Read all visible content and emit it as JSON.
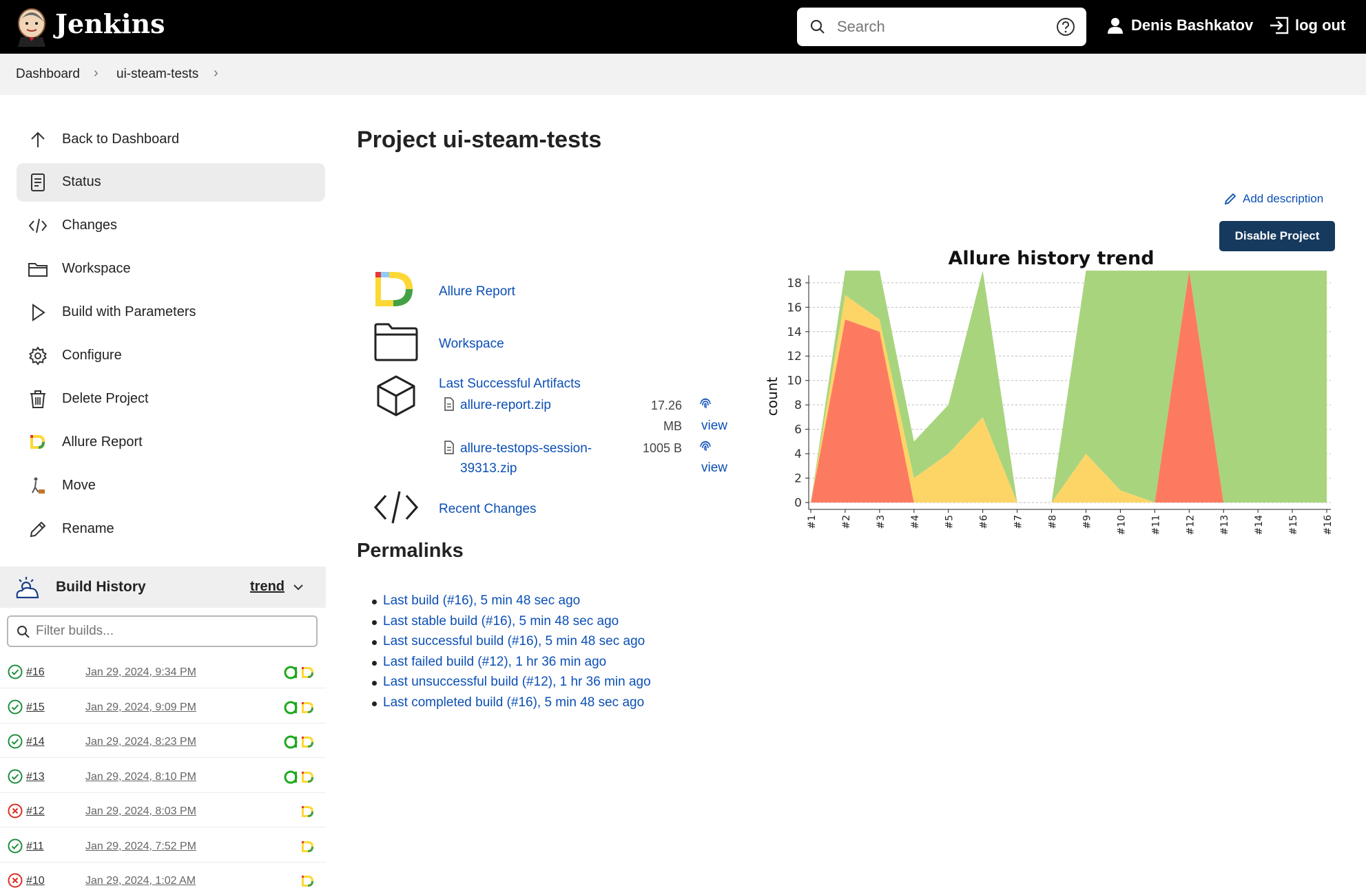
{
  "header": {
    "brand": "Jenkins",
    "search_placeholder": "Search",
    "user_name": "Denis Bashkatov",
    "logout_label": "log out"
  },
  "breadcrumb": [
    "Dashboard",
    "ui-steam-tests"
  ],
  "sidebar": {
    "items": [
      {
        "label": "Back to Dashboard",
        "icon": "arrow-up-icon"
      },
      {
        "label": "Status",
        "icon": "document-icon",
        "active": true
      },
      {
        "label": "Changes",
        "icon": "code-icon"
      },
      {
        "label": "Workspace",
        "icon": "folder-icon"
      },
      {
        "label": "Build with Parameters",
        "icon": "play-icon"
      },
      {
        "label": "Configure",
        "icon": "gear-icon"
      },
      {
        "label": "Delete Project",
        "icon": "trash-icon"
      },
      {
        "label": "Allure Report",
        "icon": "allure-icon"
      },
      {
        "label": "Move",
        "icon": "move-icon"
      },
      {
        "label": "Rename",
        "icon": "pencil-icon"
      }
    ]
  },
  "build_history": {
    "title": "Build History",
    "trend_label": "trend",
    "filter_placeholder": "Filter builds...",
    "builds": [
      {
        "number": "#16",
        "date": "Jan 29, 2024, 9:34 PM",
        "status": "success",
        "testops": true
      },
      {
        "number": "#15",
        "date": "Jan 29, 2024, 9:09 PM",
        "status": "success",
        "testops": true
      },
      {
        "number": "#14",
        "date": "Jan 29, 2024, 8:23 PM",
        "status": "success",
        "testops": true
      },
      {
        "number": "#13",
        "date": "Jan 29, 2024, 8:10 PM",
        "status": "success",
        "testops": true
      },
      {
        "number": "#12",
        "date": "Jan 29, 2024, 8:03 PM",
        "status": "failed",
        "testops": false
      },
      {
        "number": "#11",
        "date": "Jan 29, 2024, 7:52 PM",
        "status": "success",
        "testops": false
      },
      {
        "number": "#10",
        "date": "Jan 29, 2024, 1:02 AM",
        "status": "failed",
        "testops": false
      }
    ]
  },
  "main": {
    "title": "Project ui-steam-tests",
    "add_description": "Add description",
    "disable_button": "Disable Project",
    "links": {
      "allure_report": "Allure Report",
      "workspace": "Workspace",
      "last_artifacts": "Last Successful Artifacts",
      "recent_changes": "Recent Changes"
    },
    "artifacts": [
      {
        "name_line1": "allure-report.zip",
        "name_line2": "",
        "size_line1": "17.26",
        "size_line2": "MB",
        "view": "view"
      },
      {
        "name_line1": "allure-testops-session-",
        "name_line2": "39313.zip",
        "size_line1": "1005 B",
        "size_line2": "",
        "view": "view"
      }
    ],
    "permalinks_title": "Permalinks",
    "permalinks": [
      "Last build (#16), 5 min 48 sec ago",
      "Last stable build (#16), 5 min 48 sec ago",
      "Last successful build (#16), 5 min 48 sec ago",
      "Last failed build (#12), 1 hr 36 min ago",
      "Last unsuccessful build (#12), 1 hr 36 min ago",
      "Last completed build (#16), 5 min 48 sec ago"
    ]
  },
  "colors": {
    "passed": "#a8d47e",
    "broken": "#fdd567",
    "failed": "#fc7b60",
    "link": "#0b4fb5",
    "button": "#163a5e"
  },
  "chart_data": {
    "type": "area",
    "title": "Allure history trend",
    "ylabel": "count",
    "xlabel": "",
    "categories": [
      "#1",
      "#2",
      "#3",
      "#4",
      "#5",
      "#6",
      "#7",
      "#8",
      "#9",
      "#10",
      "#11",
      "#12",
      "#13",
      "#14",
      "#15",
      "#16"
    ],
    "ylim": [
      0,
      19
    ],
    "yticks": [
      0,
      2,
      4,
      6,
      8,
      10,
      12,
      14,
      16,
      18
    ],
    "grid": true,
    "stacked": true,
    "series": [
      {
        "values": [
          0,
          15,
          14,
          0,
          0,
          0,
          0,
          0,
          0,
          0,
          0,
          19,
          0,
          0,
          0,
          0
        ],
        "color": "#fc7b60"
      },
      {
        "values": [
          0,
          2,
          1,
          2,
          4,
          7,
          0,
          0,
          4,
          1,
          0,
          0,
          0,
          0,
          0,
          0
        ],
        "color": "#fdd567"
      },
      {
        "values": [
          0,
          2,
          4,
          3,
          4,
          12,
          0,
          0,
          15,
          18,
          19,
          0,
          19,
          19,
          19,
          19
        ],
        "color": "#a8d47e"
      }
    ]
  }
}
